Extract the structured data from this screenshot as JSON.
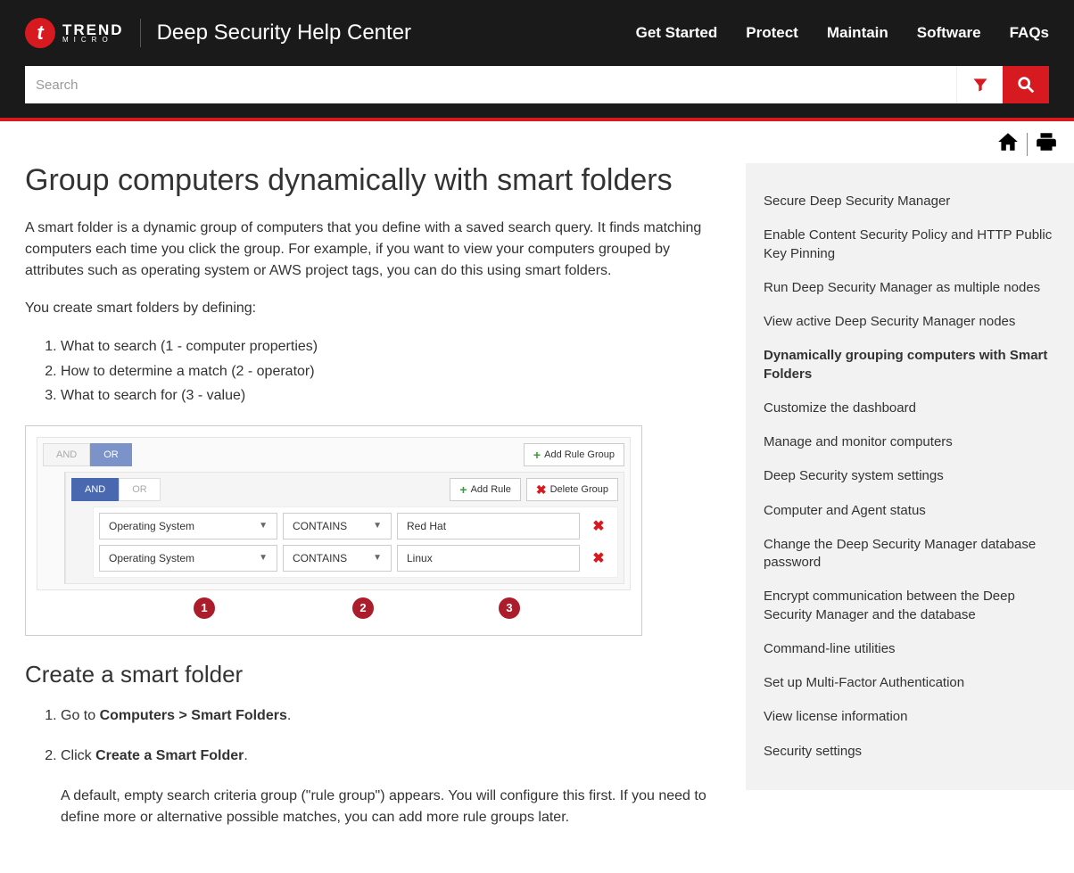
{
  "header": {
    "brand_top": "TREND",
    "brand_bottom": "MICRO",
    "site_title": "Deep Security Help Center",
    "nav": [
      "Get Started",
      "Protect",
      "Maintain",
      "Software",
      "FAQs"
    ]
  },
  "search": {
    "placeholder": "Search"
  },
  "page": {
    "title": "Group computers dynamically with smart folders",
    "intro": "A smart folder is a dynamic group of computers that you define with a saved search query. It finds matching computers each time you click the group. For example, if you want to view your computers grouped by attributes such as operating system or AWS project tags, you can do this using smart folders.",
    "define_lead": "You create smart folders by defining:",
    "define_list": [
      "What to search (1 - computer properties)",
      "How to determine a match (2 - operator)",
      "What to search for (3 - value)"
    ],
    "section2_title": "Create a smart folder",
    "steps": [
      {
        "prefix": "Go to ",
        "bold": "Computers > Smart Folders",
        "suffix": "."
      },
      {
        "prefix": "Click ",
        "bold": "Create a Smart Folder",
        "suffix": "."
      }
    ],
    "step2_after": "A default, empty search criteria group (\"rule group\") appears. You will configure this first. If you need to define more or alternative possible matches, you can add more rule groups later."
  },
  "figure": {
    "outer": {
      "and": "AND",
      "or": "OR",
      "add_group": "Add Rule Group"
    },
    "inner": {
      "and": "AND",
      "or": "OR",
      "add_rule": "Add Rule",
      "delete_group": "Delete Group"
    },
    "rules": [
      {
        "field": "Operating System",
        "op": "CONTAINS",
        "value": "Red Hat"
      },
      {
        "field": "Operating System",
        "op": "CONTAINS",
        "value": "Linux"
      }
    ],
    "bubbles": [
      "1",
      "2",
      "3"
    ]
  },
  "sidebar": [
    {
      "label": "Secure Deep Security Manager",
      "active": false
    },
    {
      "label": "Enable Content Security Policy and HTTP Public Key Pinning",
      "active": false
    },
    {
      "label": "Run Deep Security Manager as multiple nodes",
      "active": false
    },
    {
      "label": "View active Deep Security Manager nodes",
      "active": false
    },
    {
      "label": "Dynamically grouping computers with Smart Folders",
      "active": true
    },
    {
      "label": "Customize the dashboard",
      "active": false
    },
    {
      "label": "Manage and monitor computers",
      "active": false
    },
    {
      "label": "Deep Security system settings",
      "active": false
    },
    {
      "label": "Computer and Agent status",
      "active": false
    },
    {
      "label": "Change the Deep Security Manager database password",
      "active": false
    },
    {
      "label": "Encrypt communication between the Deep Security Manager and the database",
      "active": false
    },
    {
      "label": "Command-line utilities",
      "active": false
    },
    {
      "label": "Set up Multi-Factor Authentication",
      "active": false
    },
    {
      "label": "View license information",
      "active": false
    },
    {
      "label": "Security settings",
      "active": false
    }
  ]
}
